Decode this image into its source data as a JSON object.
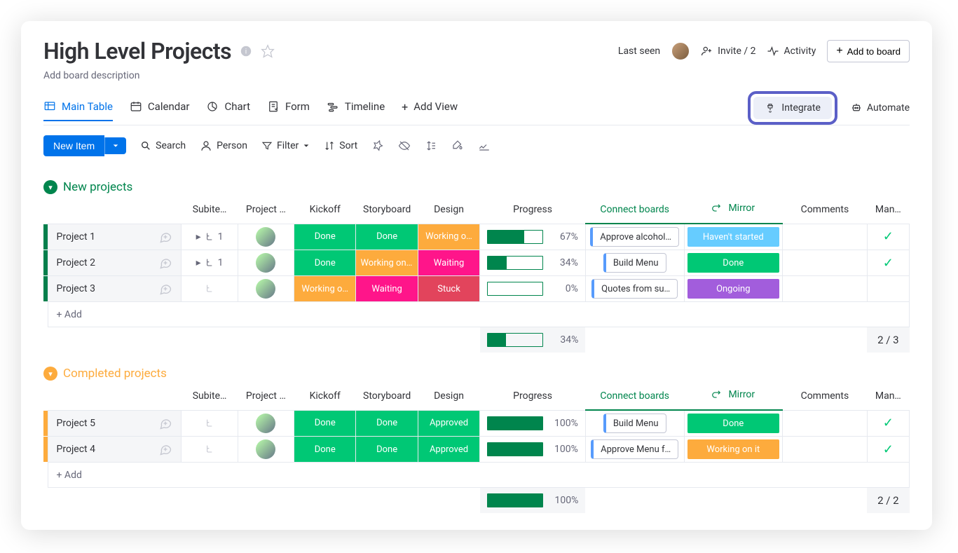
{
  "header": {
    "title": "High Level Projects",
    "description": "Add board description",
    "last_seen": "Last seen",
    "invite": "Invite / 2",
    "activity": "Activity",
    "add_to_board": "Add to board"
  },
  "views": {
    "main": "Main Table",
    "calendar": "Calendar",
    "chart": "Chart",
    "form": "Form",
    "timeline": "Timeline",
    "add": "Add View",
    "integrate": "Integrate",
    "automate": "Automate"
  },
  "toolbar": {
    "new_item": "New Item",
    "search": "Search",
    "person": "Person",
    "filter": "Filter",
    "sort": "Sort"
  },
  "columns": {
    "subitems": "Subite…",
    "owner": "Project …",
    "kickoff": "Kickoff",
    "storyboard": "Storyboard",
    "design": "Design",
    "progress": "Progress",
    "connect": "Connect boards",
    "mirror": "Mirror",
    "comments": "Comments",
    "manager": "Man…"
  },
  "groups": [
    {
      "id": "new",
      "title": "New projects",
      "color": "green",
      "rows": [
        {
          "name": "Project 1",
          "sub": "1",
          "kick": "Done",
          "kick_c": "s-done",
          "story": "Done",
          "story_c": "s-done",
          "design": "Working o…",
          "design_c": "s-work",
          "prog": 67,
          "connect": "Approve alcohol…",
          "mirror": "Haven't started",
          "mirror_c": "s-start",
          "check": true
        },
        {
          "name": "Project 2",
          "sub": "1",
          "kick": "Done",
          "kick_c": "s-done",
          "story": "Working on it",
          "story_c": "s-work",
          "design": "Waiting",
          "design_c": "s-wait-p",
          "prog": 34,
          "connect": "Build Menu",
          "mirror": "Done",
          "mirror_c": "s-done",
          "check": true
        },
        {
          "name": "Project 3",
          "sub": "",
          "kick": "Working o…",
          "kick_c": "s-work",
          "story": "Waiting",
          "story_c": "s-wait-p",
          "design": "Stuck",
          "design_c": "s-stuck",
          "prog": 0,
          "connect": "Quotes from su…",
          "mirror": "Ongoing",
          "mirror_c": "s-ongoing",
          "check": false
        }
      ],
      "add": "+ Add",
      "summary_prog": 34,
      "summary_count": "2 / 3"
    },
    {
      "id": "completed",
      "title": "Completed projects",
      "color": "yellow",
      "rows": [
        {
          "name": "Project 5",
          "sub": "",
          "kick": "Done",
          "kick_c": "s-done",
          "story": "Done",
          "story_c": "s-done",
          "design": "Approved",
          "design_c": "s-appr",
          "prog": 100,
          "connect": "Build Menu",
          "mirror": "Done",
          "mirror_c": "s-done",
          "check": true
        },
        {
          "name": "Project 4",
          "sub": "",
          "kick": "Done",
          "kick_c": "s-done",
          "story": "Done",
          "story_c": "s-done",
          "design": "Approved",
          "design_c": "s-appr",
          "prog": 100,
          "connect": "Approve Menu f…",
          "mirror": "Working on it",
          "mirror_c": "s-work",
          "check": true
        }
      ],
      "add": "+ Add",
      "summary_prog": 100,
      "summary_count": "2 / 2"
    }
  ]
}
